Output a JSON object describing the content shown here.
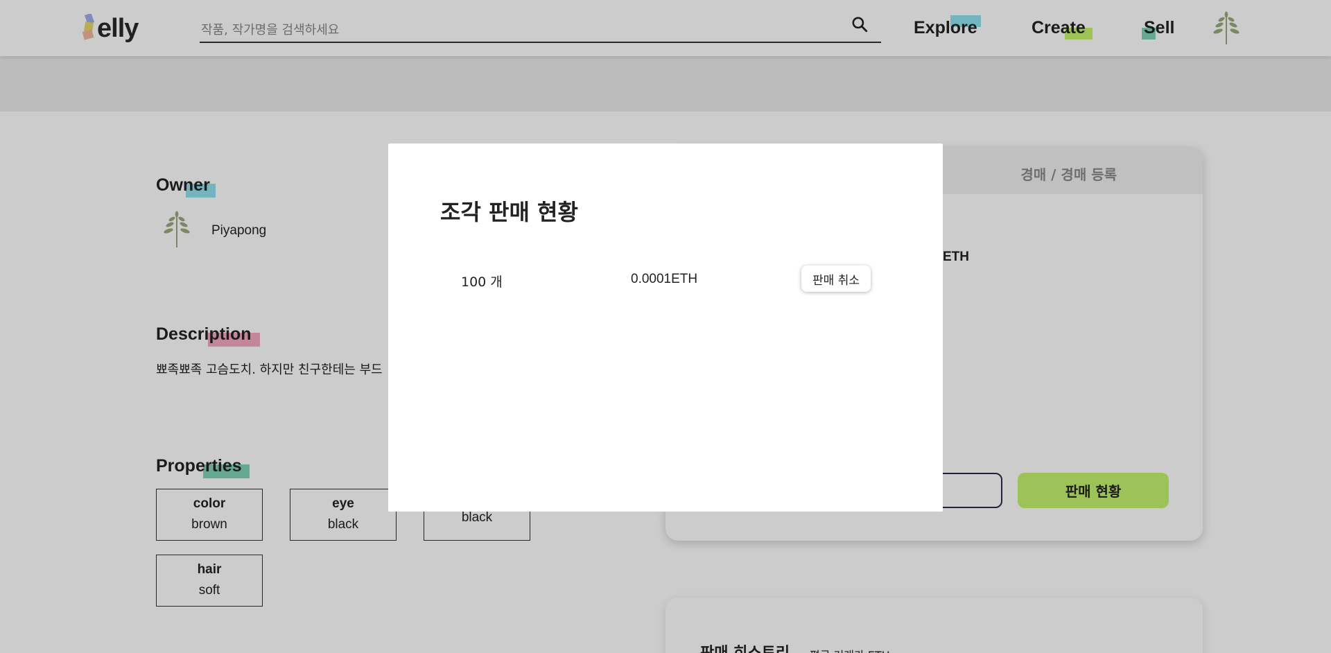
{
  "header": {
    "logo_text": "elly",
    "search_placeholder": "작품, 작가명을 검색하세요",
    "nav": [
      {
        "label": "Explore",
        "highlight": "#8fe3ee"
      },
      {
        "label": "Create",
        "highlight": "#c5f36d"
      },
      {
        "label": "Sell",
        "highlight": "#7fd4b8"
      }
    ]
  },
  "owner": {
    "title": "Owner",
    "name": "Piyapong"
  },
  "description": {
    "title": "Description",
    "text": "뾰족뾰족 고슴도치. 하지만 친구한테는 부드"
  },
  "properties": {
    "title": "Properties",
    "items": [
      {
        "key": "color",
        "value": "brown"
      },
      {
        "key": "eye",
        "value": "black"
      },
      {
        "key": "",
        "value": "black"
      },
      {
        "key": "hair",
        "value": "soft"
      }
    ]
  },
  "trade_card": {
    "tab_right": "경매 / 경매 등록",
    "price_fragment": "ETH",
    "status_button": "판매 현황"
  },
  "history": {
    "title": "판매 히스토리",
    "subtitle": "평균 거래가 ETH"
  },
  "modal": {
    "title": "조각 판매 현황",
    "rows": [
      {
        "quantity": "100 개",
        "price": "0.0001ETH",
        "cancel_label": "판매 취소"
      }
    ]
  },
  "colors": {
    "accent_blue": "#8fe3ee",
    "accent_green": "#c5f36d",
    "accent_pink": "#f4a9c0",
    "accent_teal": "#7fd4b8"
  }
}
